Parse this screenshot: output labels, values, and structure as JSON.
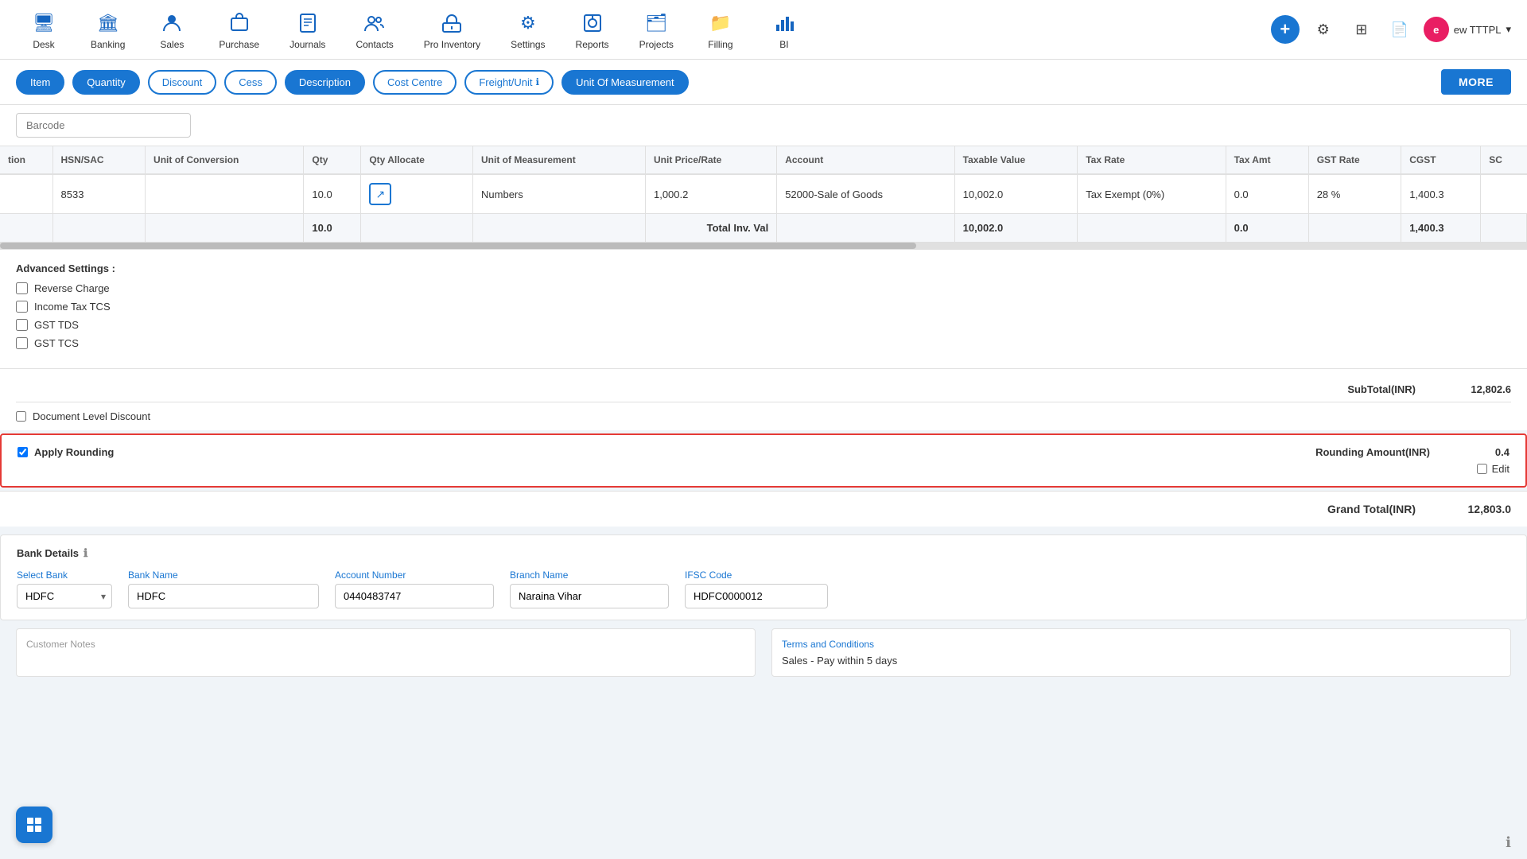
{
  "nav": {
    "items": [
      {
        "id": "desk",
        "label": "Desk",
        "icon": "🖥"
      },
      {
        "id": "banking",
        "label": "Banking",
        "icon": "🏛"
      },
      {
        "id": "sales",
        "label": "Sales",
        "icon": "👤"
      },
      {
        "id": "purchase",
        "label": "Purchase",
        "icon": "🛒"
      },
      {
        "id": "journals",
        "label": "Journals",
        "icon": "📋"
      },
      {
        "id": "contacts",
        "label": "Contacts",
        "icon": "👥"
      },
      {
        "id": "pro-inventory",
        "label": "Pro Inventory",
        "icon": "📦"
      },
      {
        "id": "settings",
        "label": "Settings",
        "icon": "⚙"
      },
      {
        "id": "reports",
        "label": "Reports",
        "icon": "📊"
      },
      {
        "id": "projects",
        "label": "Projects",
        "icon": "🗂"
      },
      {
        "id": "filling",
        "label": "Filling",
        "icon": "📁"
      },
      {
        "id": "bi",
        "label": "BI",
        "icon": "📈"
      }
    ],
    "user_label": "ew TTTPL"
  },
  "filter_tabs": {
    "items": [
      {
        "id": "item",
        "label": "Item",
        "active": true
      },
      {
        "id": "quantity",
        "label": "Quantity",
        "active": true
      },
      {
        "id": "discount",
        "label": "Discount",
        "active": false
      },
      {
        "id": "cess",
        "label": "Cess",
        "active": false
      },
      {
        "id": "description",
        "label": "Description",
        "active": true
      },
      {
        "id": "cost-centre",
        "label": "Cost Centre",
        "active": false
      },
      {
        "id": "freight-unit",
        "label": "Freight/Unit",
        "active": false,
        "has_info": true
      },
      {
        "id": "unit-of-measurement",
        "label": "Unit Of Measurement",
        "active": true,
        "highlight": true
      }
    ],
    "more_label": "MORE"
  },
  "barcode": {
    "placeholder": "Barcode"
  },
  "table": {
    "columns": [
      {
        "id": "tion",
        "label": "tion"
      },
      {
        "id": "hsn-sac",
        "label": "HSN/SAC"
      },
      {
        "id": "unit-of-conversion",
        "label": "Unit of Conversion"
      },
      {
        "id": "qty",
        "label": "Qty"
      },
      {
        "id": "qty-allocate",
        "label": "Qty Allocate"
      },
      {
        "id": "unit-of-measurement",
        "label": "Unit of Measurement"
      },
      {
        "id": "unit-price-rate",
        "label": "Unit Price/Rate"
      },
      {
        "id": "account",
        "label": "Account"
      },
      {
        "id": "taxable-value",
        "label": "Taxable Value"
      },
      {
        "id": "tax-rate",
        "label": "Tax Rate"
      },
      {
        "id": "tax-amt",
        "label": "Tax Amt"
      },
      {
        "id": "gst-rate",
        "label": "GST Rate"
      },
      {
        "id": "cgst",
        "label": "CGST"
      },
      {
        "id": "sc",
        "label": "SC"
      }
    ],
    "rows": [
      {
        "tion": "",
        "hsn_sac": "8533",
        "unit_conversion": "",
        "qty": "10.0",
        "qty_allocate": "☐",
        "unit_measurement": "Numbers",
        "unit_price": "1,000.2",
        "account": "52000-Sale of Goods",
        "taxable_value": "10,002.0",
        "tax_rate": "Tax Exempt (0%)",
        "tax_amt": "0.0",
        "gst_rate": "28 %",
        "cgst": "1,400.3",
        "sc": ""
      }
    ],
    "total_row": {
      "qty": "10.0",
      "label": "Total Inv. Val",
      "taxable_value": "10,002.0",
      "tax_amt": "0.0",
      "cgst": "1,400.3"
    }
  },
  "advanced_settings": {
    "title": "Advanced Settings :",
    "checkboxes": [
      {
        "id": "reverse-charge",
        "label": "Reverse Charge",
        "checked": false
      },
      {
        "id": "income-tax-tcs",
        "label": "Income Tax TCS",
        "checked": false
      },
      {
        "id": "gst-tds",
        "label": "GST TDS",
        "checked": false
      },
      {
        "id": "gst-tcs",
        "label": "GST TCS",
        "checked": false
      }
    ]
  },
  "totals": {
    "subtotal_label": "SubTotal(INR)",
    "subtotal_value": "12,802.6",
    "doc_discount_label": "Document Level Discount",
    "rounding_label": "Apply Rounding",
    "rounding_amount_label": "Rounding Amount(INR)",
    "rounding_amount_value": "0.4",
    "edit_label": "Edit",
    "grand_total_label": "Grand Total(INR)",
    "grand_total_value": "12,803.0"
  },
  "bank_details": {
    "title": "Bank Details",
    "select_bank_label": "Select Bank",
    "select_bank_value": "HDFC",
    "bank_name_label": "Bank Name",
    "bank_name_value": "HDFC",
    "account_number_label": "Account Number",
    "account_number_value": "0440483747",
    "branch_name_label": "Branch Name",
    "branch_name_value": "Naraina Vihar",
    "ifsc_code_label": "IFSC Code",
    "ifsc_code_value": "HDFC0000012"
  },
  "notes": {
    "label": "Customer Notes"
  },
  "terms": {
    "label": "Terms and Conditions",
    "value": "Sales - Pay within 5 days"
  }
}
